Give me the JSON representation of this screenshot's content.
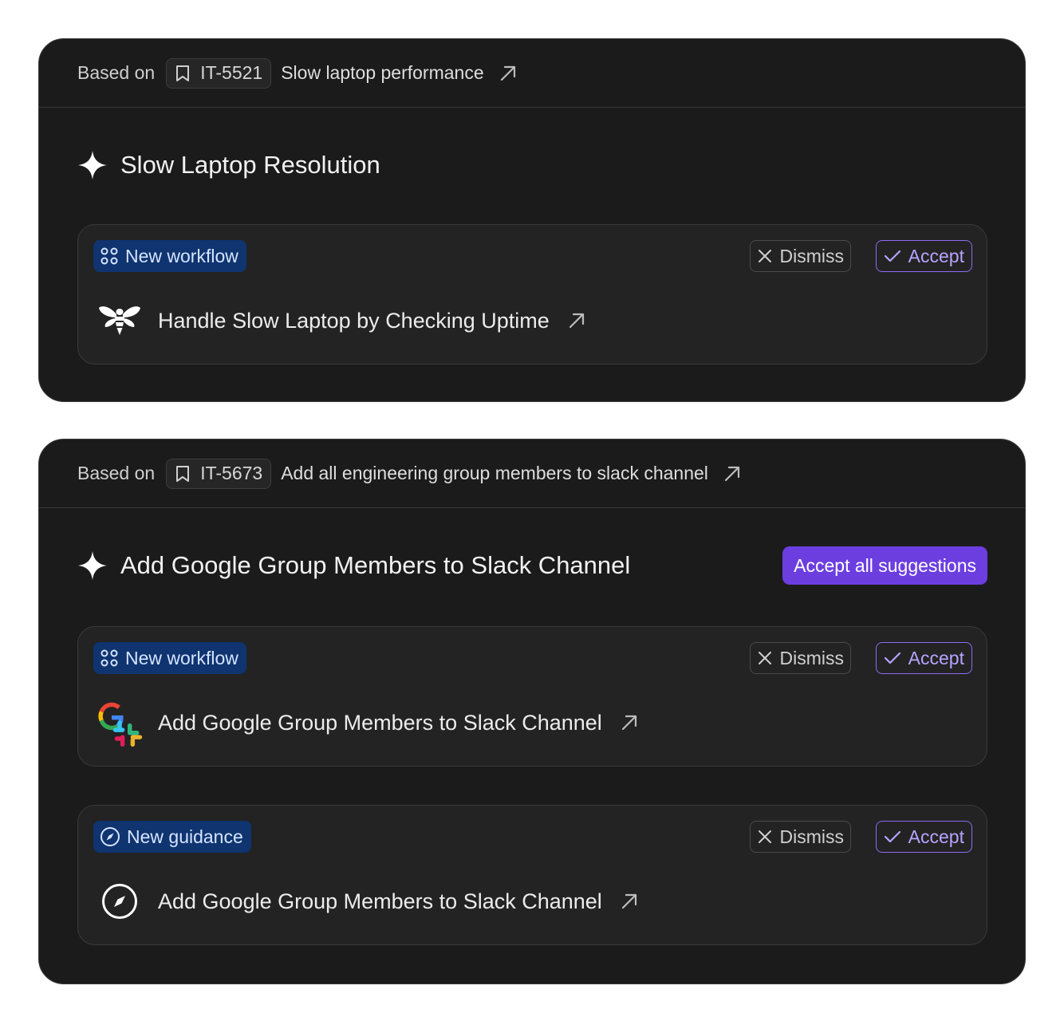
{
  "cards": [
    {
      "based_on_label": "Based on",
      "ticket_id": "IT-5521",
      "ticket_title": "Slow laptop performance",
      "title": "Slow Laptop Resolution",
      "suggestions": [
        {
          "badge": "New workflow",
          "dismiss_label": "Dismiss",
          "accept_label": "Accept",
          "item_title": "Handle Slow Laptop by Checking Uptime",
          "icon": "bee-logo-icon"
        }
      ]
    },
    {
      "based_on_label": "Based on",
      "ticket_id": "IT-5673",
      "ticket_title": "Add all engineering group members to slack channel",
      "title": "Add Google Group Members to Slack Channel",
      "accept_all_label": "Accept all suggestions",
      "suggestions": [
        {
          "badge": "New workflow",
          "dismiss_label": "Dismiss",
          "accept_label": "Accept",
          "item_title": "Add Google Group Members to Slack Channel",
          "icon": "google-slack-icon"
        },
        {
          "badge": "New guidance",
          "dismiss_label": "Dismiss",
          "accept_label": "Accept",
          "item_title": "Add Google Group Members to Slack Channel",
          "icon": "compass-icon"
        }
      ]
    }
  ],
  "colors": {
    "card_bg": "#1b1b1b",
    "suggestion_bg": "#232323",
    "border": "#3a3a3a",
    "badge_bg": "#0f3470",
    "accent": "#6c3ee0",
    "accept_border": "#8a6cf4"
  }
}
